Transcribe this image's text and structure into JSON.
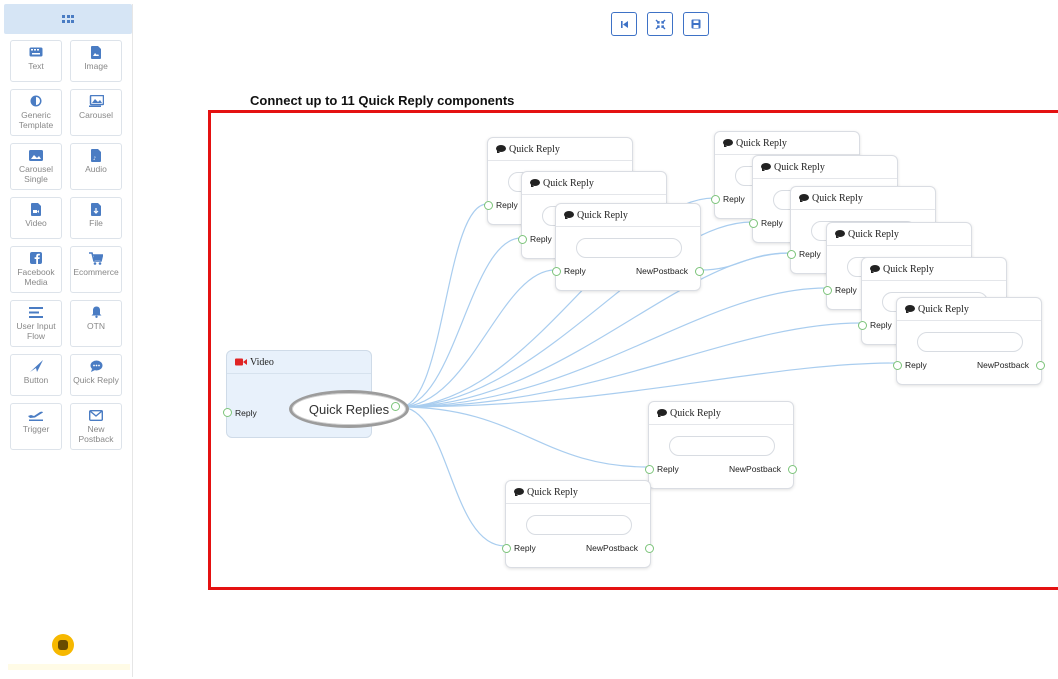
{
  "sidebar": {
    "items": [
      {
        "label": "Text",
        "icon": "keyboard-icon"
      },
      {
        "label": "Image",
        "icon": "image-file-icon"
      },
      {
        "label": "Generic Template",
        "icon": "half-circle-icon"
      },
      {
        "label": "Carousel",
        "icon": "carousel-icon"
      },
      {
        "label": "Carousel Single",
        "icon": "carousel-single-icon"
      },
      {
        "label": "Audio",
        "icon": "audio-file-icon"
      },
      {
        "label": "Video",
        "icon": "video-file-icon"
      },
      {
        "label": "File",
        "icon": "file-download-icon"
      },
      {
        "label": "Facebook Media",
        "icon": "facebook-icon"
      },
      {
        "label": "Ecommerce",
        "icon": "cart-icon"
      },
      {
        "label": "User Input Flow",
        "icon": "lines-icon"
      },
      {
        "label": "OTN",
        "icon": "bell-icon"
      },
      {
        "label": "Button",
        "icon": "send-icon"
      },
      {
        "label": "Quick Reply",
        "icon": "chat-icon"
      },
      {
        "label": "Trigger",
        "icon": "plane-icon"
      },
      {
        "label": "New Postback",
        "icon": "envelope-icon"
      }
    ]
  },
  "toolbar": {
    "buttons": [
      {
        "icon": "first-page-icon"
      },
      {
        "icon": "fit-screen-icon"
      },
      {
        "icon": "save-icon"
      }
    ]
  },
  "heading": "Connect up to 11 Quick Reply components",
  "video_node": {
    "title": "Video",
    "reply_label": "Reply"
  },
  "hub": {
    "label": "Quick Replies"
  },
  "quick_reply_nodes": [
    {
      "title": "Quick Reply",
      "reply_label": "Reply",
      "postback_label": ""
    },
    {
      "title": "Quick Reply",
      "reply_label": "Reply",
      "postback_label": ""
    },
    {
      "title": "Quick Reply",
      "reply_label": "Reply",
      "postback_label": "NewPostback"
    },
    {
      "title": "Quick Reply",
      "reply_label": "Reply",
      "postback_label": ""
    },
    {
      "title": "Quick Reply",
      "reply_label": "Reply",
      "postback_label": ""
    },
    {
      "title": "Quick Reply",
      "reply_label": "Reply",
      "postback_label": ""
    },
    {
      "title": "Quick Reply",
      "reply_label": "Reply",
      "postback_label": ""
    },
    {
      "title": "Quick Reply",
      "reply_label": "Reply",
      "postback_label": ""
    },
    {
      "title": "Quick Reply",
      "reply_label": "Reply",
      "postback_label": ""
    },
    {
      "title": "Quick Reply",
      "reply_label": "Reply",
      "postback_label": "NewPostback"
    },
    {
      "title": "Quick Reply",
      "reply_label": "Reply",
      "postback_label": "NewPostback"
    },
    {
      "title": "Quick Reply",
      "reply_label": "Reply",
      "postback_label": "NewPostback"
    }
  ],
  "colors": {
    "accent": "#3e72c6",
    "border_highlight": "#e41111",
    "wire": "#a9cdef",
    "port": "#7cc47a",
    "video_icon": "#e02424",
    "panel_head": "#d6e5f5"
  }
}
